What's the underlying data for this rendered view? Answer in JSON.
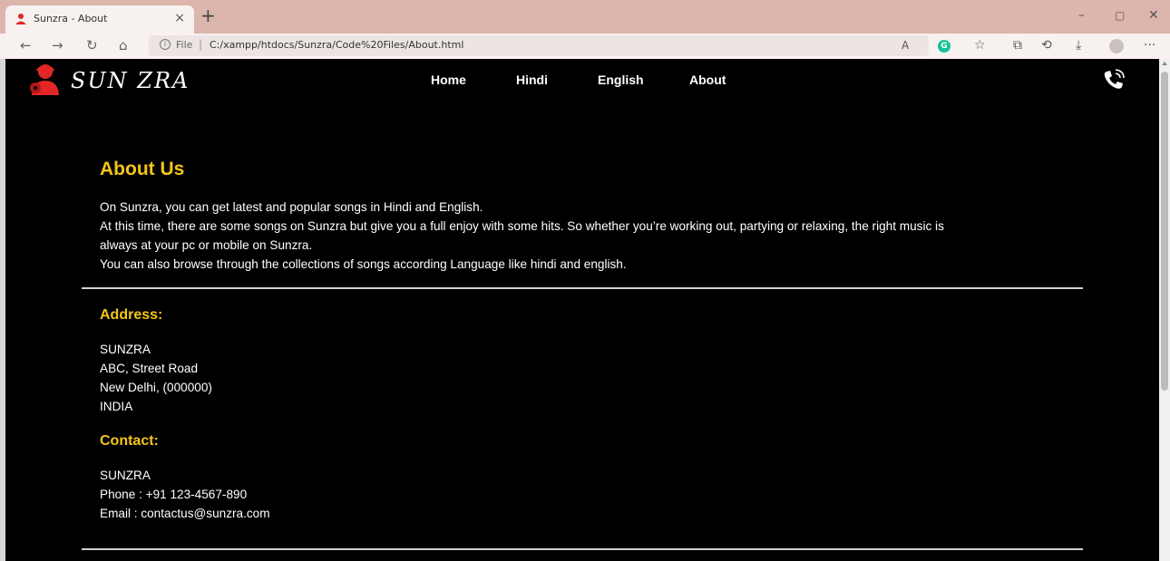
{
  "browser": {
    "tab_title": "Sunzra - About",
    "tab_close": "×",
    "new_tab": "+",
    "window_controls": {
      "minimize": "–",
      "restore": "▢",
      "close": "✕"
    },
    "nav": {
      "back": "←",
      "forward": "→",
      "reload": "↻",
      "home": "⌂"
    },
    "address": {
      "info": "i",
      "scheme_label": "File",
      "separator": "|",
      "url": "C:/xampp/htdocs/Sunzra/Code%20Files/About.html"
    },
    "toolbar": {
      "read_aloud": "A",
      "grammarly": "G",
      "favorites": "☆",
      "collections": "⧉",
      "history": "⟲",
      "downloads": "⤓",
      "more": "···"
    }
  },
  "site": {
    "brand": "SUN ZRA",
    "nav": [
      "Home",
      "Hindi",
      "English",
      "About"
    ]
  },
  "about": {
    "heading": "About Us",
    "paragraphs": [
      "On Sunzra, you can get latest and popular songs in Hindi and English.",
      "At this time, there are some songs on Sunzra but give you a full enjoy with some hits. So whether you’re working out, partying or relaxing, the right music is",
      "always at your pc or mobile on Sunzra.",
      "You can also browse through the collections of songs according Language like hindi and english."
    ]
  },
  "address": {
    "heading": "Address:",
    "lines": [
      "SUNZRA",
      "ABC, Street Road",
      "New Delhi, (000000)",
      "INDIA"
    ]
  },
  "contact": {
    "heading": "Contact:",
    "lines": [
      "SUNZRA",
      "Phone : +91 123-4567-890",
      "Email : contactus@sunzra.com"
    ]
  },
  "colors": {
    "accent": "#f5c518",
    "page_bg": "#000000",
    "tab_strip": "#dcb5ad",
    "logo_red": "#e22626"
  }
}
